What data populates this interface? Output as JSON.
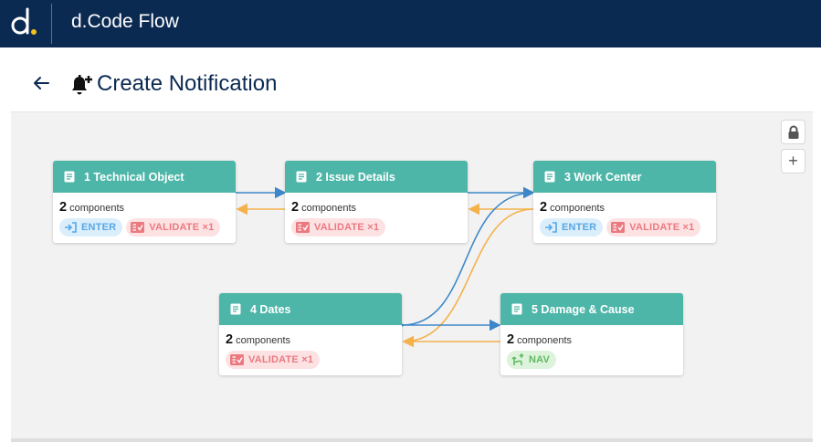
{
  "app": {
    "title": "d.Code Flow"
  },
  "page": {
    "title": "Create Notification"
  },
  "controls": {
    "lock": "lock",
    "zoom_in": "+"
  },
  "nodes": [
    {
      "title": "1 Technical Object",
      "count": "2",
      "count_label": "components",
      "chips": [
        {
          "type": "enter",
          "label": "ENTER"
        },
        {
          "type": "validate",
          "label": "VALIDATE ×1"
        }
      ]
    },
    {
      "title": "2 Issue Details",
      "count": "2",
      "count_label": "components",
      "chips": [
        {
          "type": "validate",
          "label": "VALIDATE ×1"
        }
      ]
    },
    {
      "title": "3 Work Center",
      "count": "2",
      "count_label": "components",
      "chips": [
        {
          "type": "enter",
          "label": "ENTER"
        },
        {
          "type": "validate",
          "label": "VALIDATE ×1"
        }
      ]
    },
    {
      "title": "4 Dates",
      "count": "2",
      "count_label": "components",
      "chips": [
        {
          "type": "validate",
          "label": "VALIDATE ×1"
        }
      ]
    },
    {
      "title": "5 Damage & Cause",
      "count": "2",
      "count_label": "components",
      "chips": [
        {
          "type": "nav",
          "label": "NAV"
        }
      ]
    }
  ],
  "colors": {
    "header_bg": "#0b2a52",
    "node_header": "#4db6a8",
    "forward_edge": "#3d87c9",
    "back_edge": "#f5b14c"
  }
}
